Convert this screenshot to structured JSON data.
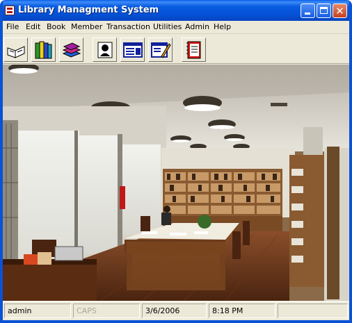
{
  "window": {
    "title": "Library Managment System",
    "accent_color": "#0a52d6",
    "controls": {
      "minimize": "minimize-icon",
      "maximize": "maximize-icon",
      "close": "close-icon"
    },
    "close_glyph": "✕"
  },
  "menubar": {
    "items": [
      {
        "label": "File"
      },
      {
        "label": "Edit"
      },
      {
        "label": "Book"
      },
      {
        "label": "Member"
      },
      {
        "label": "Transaction"
      },
      {
        "label": "Utilities"
      },
      {
        "label": "Admin"
      },
      {
        "label": "Help"
      }
    ]
  },
  "toolbar": {
    "buttons": [
      {
        "icon": "open-book-icon"
      },
      {
        "icon": "books-shelf-icon"
      },
      {
        "icon": "book-stack-icon"
      },
      {
        "icon": "member-icon"
      },
      {
        "icon": "transaction-form-icon"
      },
      {
        "icon": "edit-record-icon"
      },
      {
        "icon": "report-notebook-icon"
      }
    ]
  },
  "background_image": {
    "icon": "library-reading-room-photo"
  },
  "statusbar": {
    "user": "admin",
    "caps": "CAPS",
    "date": "3/6/2006",
    "time": "8:18 PM",
    "extra": ""
  }
}
